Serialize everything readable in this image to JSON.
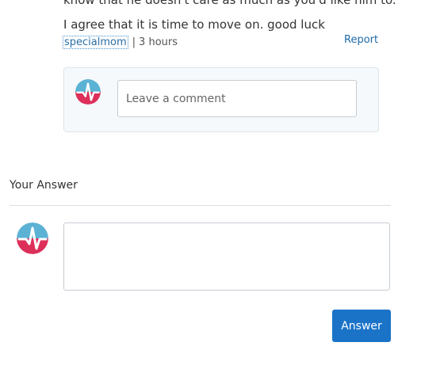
{
  "comment": {
    "cut_line": "know that he doesn't care as much as you'd like him to.",
    "text": "I agree that it is time to move on.  good luck",
    "author": "specialmom",
    "separator": "|",
    "time": "3 hours",
    "report_label": "Report"
  },
  "comment_form": {
    "placeholder": "Leave a comment"
  },
  "answer_section": {
    "heading": "Your Answer",
    "button_label": "Answer"
  },
  "colors": {
    "avatar_top": "#5bb2d4",
    "avatar_bottom": "#dc2f5a",
    "pulse": "#ffffff",
    "accent": "#1a73c7",
    "link": "#2a6ea6"
  },
  "icons": {
    "avatar": "heartbeat-avatar-icon"
  }
}
